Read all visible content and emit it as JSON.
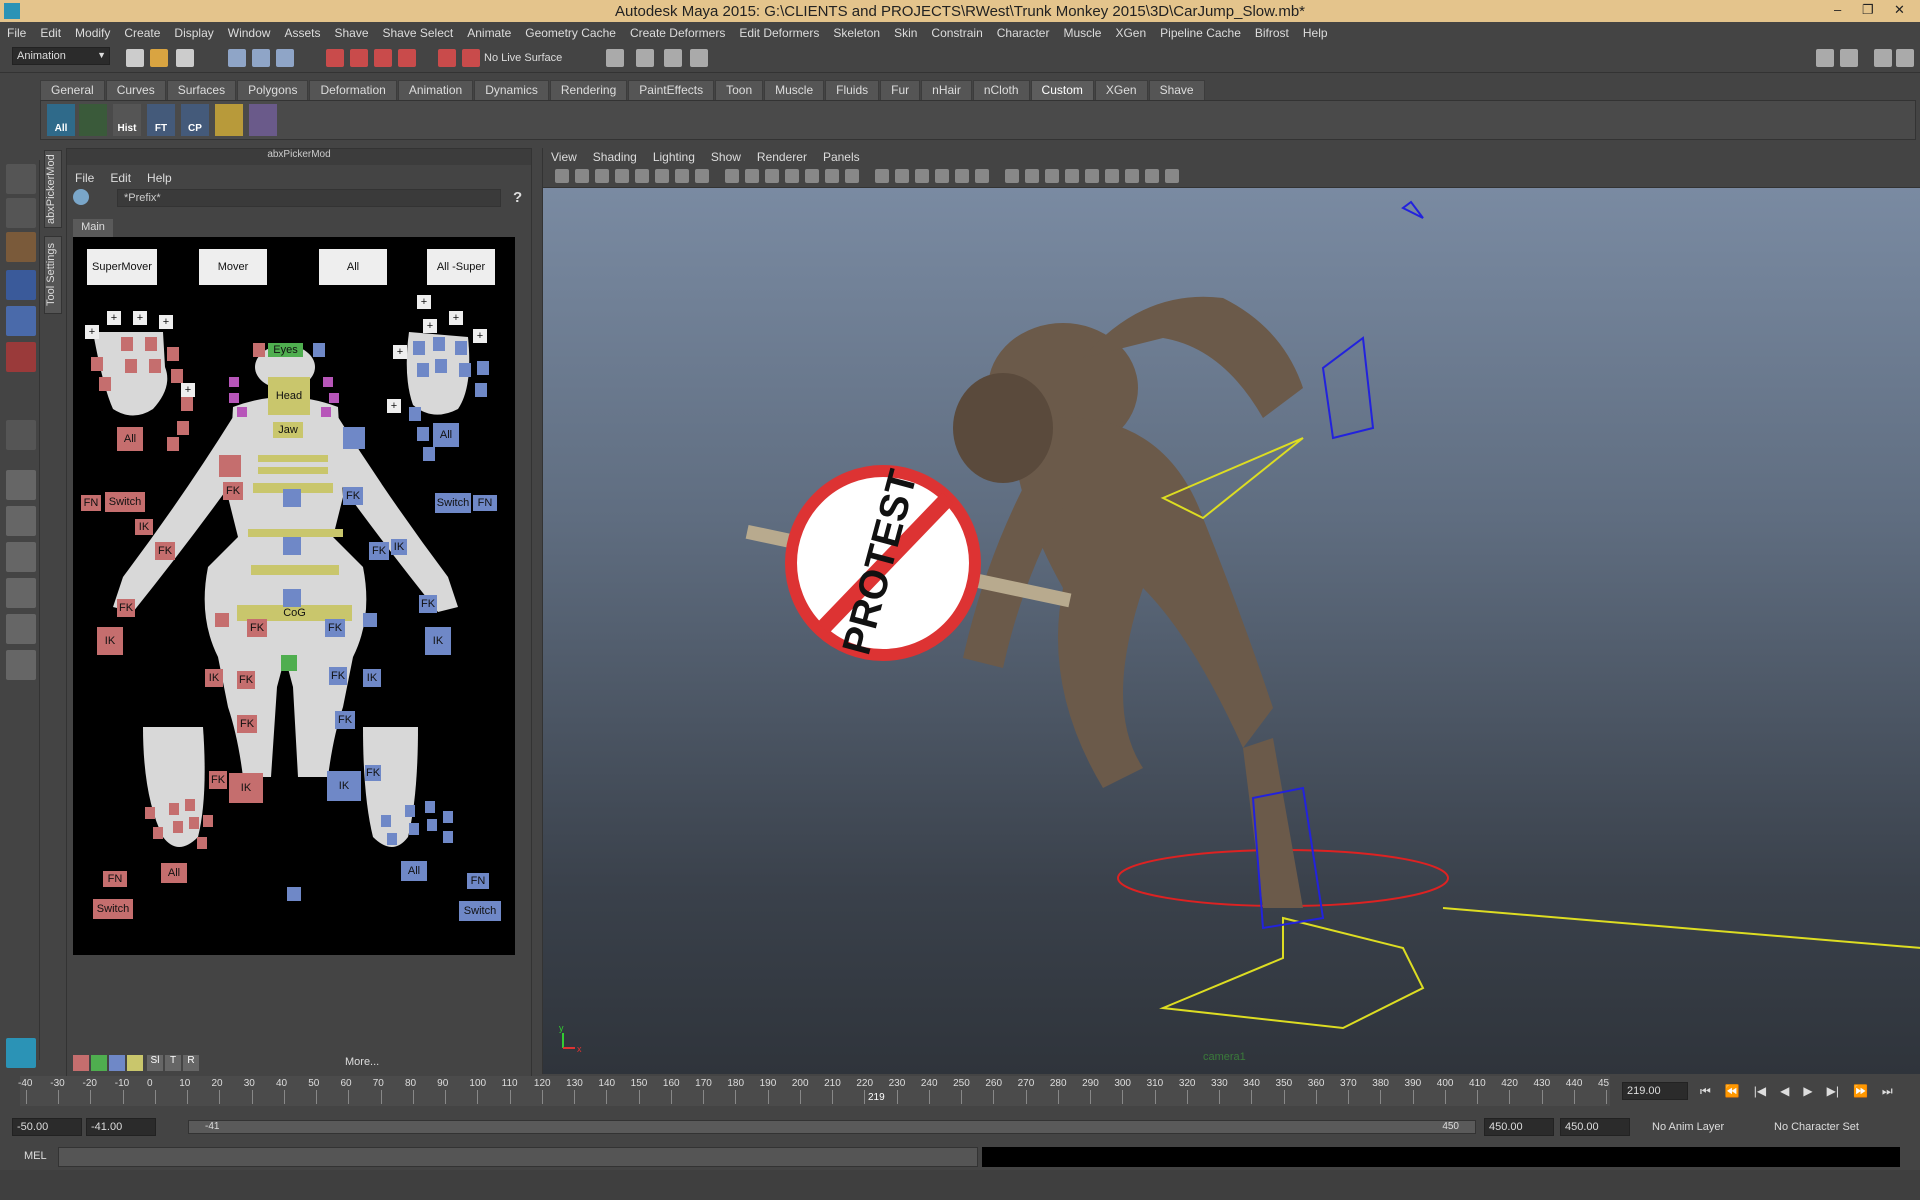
{
  "window": {
    "title": "Autodesk Maya 2015: G:\\CLIENTS and PROJECTS\\RWest\\Trunk Monkey 2015\\3D\\CarJump_Slow.mb*",
    "min": "–",
    "max": "❐",
    "close": "✕"
  },
  "menus": [
    "File",
    "Edit",
    "Modify",
    "Create",
    "Display",
    "Window",
    "Assets",
    "Shave",
    "Shave Select",
    "Animate",
    "Geometry Cache",
    "Create Deformers",
    "Edit Deformers",
    "Skeleton",
    "Skin",
    "Constrain",
    "Character",
    "Muscle",
    "XGen",
    "Pipeline Cache",
    "Bifrost",
    "Help"
  ],
  "status_line": {
    "mode": "Animation",
    "live_surface": "No Live Surface"
  },
  "shelf_tabs": [
    "General",
    "Curves",
    "Surfaces",
    "Polygons",
    "Deformation",
    "Animation",
    "Dynamics",
    "Rendering",
    "PaintEffects",
    "Toon",
    "Muscle",
    "Fluids",
    "Fur",
    "nHair",
    "nCloth",
    "Custom",
    "XGen",
    "Shave"
  ],
  "shelf_active": "Custom",
  "shelf_buttons": [
    "All",
    "",
    "Hist",
    "FT",
    "CP",
    "",
    ""
  ],
  "side_tabs": [
    "abxPickerMod",
    "Tool Settings"
  ],
  "picker": {
    "title": "abxPickerMod",
    "menu": [
      "File",
      "Edit",
      "Help"
    ],
    "prefix": "*Prefix*",
    "help": "?",
    "tab": "Main",
    "top_buttons": [
      "SuperMover",
      "Mover",
      "All",
      "All -Super"
    ],
    "labels": {
      "eyes": "Eyes",
      "head": "Head",
      "jaw": "Jaw",
      "cog": "CoG",
      "all": "All",
      "fk": "FK",
      "ik": "IK",
      "fn": "FN",
      "switch": "Switch",
      "plus": "+"
    },
    "swatches": [
      "#c56e6e",
      "#4fae4f",
      "#6f88c7",
      "#c9c66c"
    ],
    "swatch_labels": [
      "Sl",
      "T",
      "R"
    ],
    "more": "More..."
  },
  "viewport": {
    "menu": [
      "View",
      "Shading",
      "Lighting",
      "Show",
      "Renderer",
      "Panels"
    ],
    "camera_label": "camera1",
    "sign_text": "PROTEST",
    "axis_x": "x",
    "axis_y": "y"
  },
  "time": {
    "ticks": [
      "-40",
      "-30",
      "-20",
      "-10",
      "0",
      "10",
      "20",
      "30",
      "40",
      "50",
      "60",
      "70",
      "80",
      "90",
      "100",
      "110",
      "120",
      "130",
      "140",
      "150",
      "160",
      "170",
      "180",
      "190",
      "200",
      "210",
      "220",
      "230",
      "240",
      "250",
      "260",
      "270",
      "280",
      "290",
      "300",
      "310",
      "320",
      "330",
      "340",
      "350",
      "360",
      "370",
      "380",
      "390",
      "400",
      "410",
      "420",
      "430",
      "440",
      "45"
    ],
    "current": "219.00",
    "current_marker": "219",
    "range_start": "-50.00",
    "range_inner_start": "-41.00",
    "slider_start": "-41",
    "slider_end": "450",
    "range_inner_end": "450.00",
    "range_end": "450.00",
    "anim_layer": "No Anim Layer",
    "char_set": "No Character Set"
  },
  "mel": {
    "label": "MEL"
  }
}
